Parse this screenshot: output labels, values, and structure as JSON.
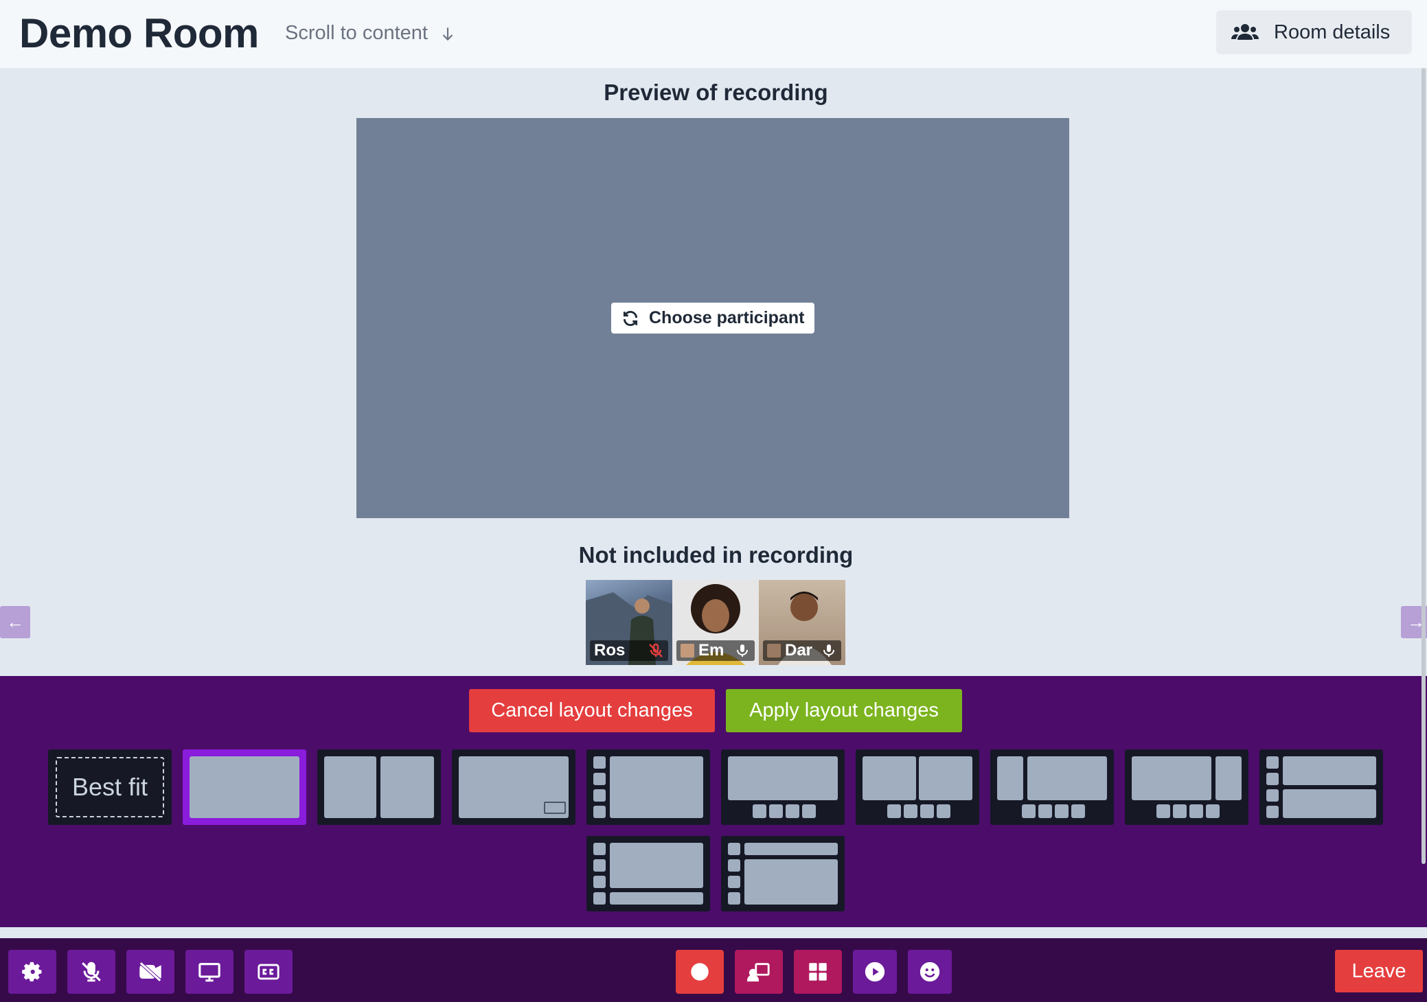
{
  "header": {
    "title": "Demo Room",
    "scroll_link": "Scroll to content",
    "room_details": "Room details"
  },
  "preview": {
    "title": "Preview of recording",
    "choose_participant": "Choose participant"
  },
  "not_included": {
    "title": "Not included in recording",
    "participants": [
      {
        "name": "Ros",
        "mic": "muted"
      },
      {
        "name": "Em",
        "mic": "on"
      },
      {
        "name": "Dar",
        "mic": "on"
      }
    ]
  },
  "layout": {
    "cancel": "Cancel layout changes",
    "apply": "Apply layout changes",
    "best_fit": "Best fit",
    "selected_index": 1
  },
  "toolbar": {
    "leave": "Leave",
    "buttons": [
      "settings-icon",
      "mic-off-icon",
      "camera-off-icon",
      "screen-share-icon",
      "captions-icon",
      "record-icon",
      "switch-layout-icon",
      "grid-layout-icon",
      "play-icon",
      "emoji-icon"
    ]
  },
  "colors": {
    "panel": "#4c0c6a",
    "toolbar": "#360a48",
    "accent_red": "#e53e3e",
    "accent_green": "#7cb41f",
    "selected": "#8a1cdb"
  }
}
